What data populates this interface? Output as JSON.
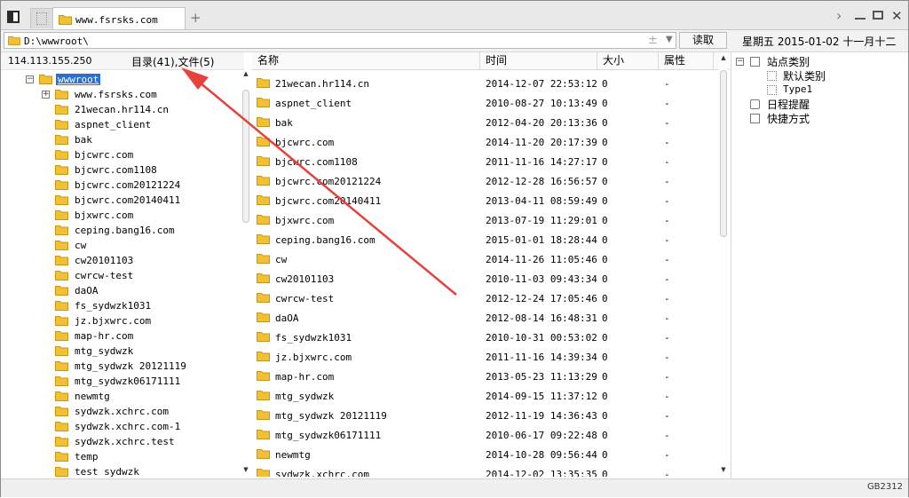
{
  "tab": {
    "title": "www.fsrsks.com"
  },
  "address": {
    "path": "D:\\wwwroot\\",
    "read_button": "读取",
    "date_text": "星期五 2015-01-02 十一月十二"
  },
  "info": {
    "ip": "114.113.155.250",
    "counts": "目录(41),文件(5)"
  },
  "tree": {
    "root": "wwwroot",
    "items": [
      "www.fsrsks.com",
      "21wecan.hr114.cn",
      "aspnet_client",
      "bak",
      "bjcwrc.com",
      "bjcwrc.com1108",
      "bjcwrc.com20121224",
      "bjcwrc.com20140411",
      "bjxwrc.com",
      "ceping.bang16.com",
      "cw",
      "cw20101103",
      "cwrcw-test",
      "daOA",
      "fs_sydwzk1031",
      "jz.bjxwrc.com",
      "map-hr.com",
      "mtg_sydwzk",
      "mtg_sydwzk 20121119",
      "mtg_sydwzk06171111",
      "newmtg",
      "sydwzk.xchrc.com",
      "sydwzk.xchrc.com-1",
      "sydwzk.xchrc.test",
      "temp",
      "test_sydwzk"
    ]
  },
  "columns": {
    "name": "名称",
    "time": "时间",
    "size": "大小",
    "attr": "属性"
  },
  "files": [
    {
      "name": "21wecan.hr114.cn",
      "time": "2014-12-07 22:53:12",
      "size": "0",
      "attr": "-"
    },
    {
      "name": "aspnet_client",
      "time": "2010-08-27 10:13:49",
      "size": "0",
      "attr": "-"
    },
    {
      "name": "bak",
      "time": "2012-04-20 20:13:36",
      "size": "0",
      "attr": "-"
    },
    {
      "name": "bjcwrc.com",
      "time": "2014-11-20 20:17:39",
      "size": "0",
      "attr": "-"
    },
    {
      "name": "bjcwrc.com1108",
      "time": "2011-11-16 14:27:17",
      "size": "0",
      "attr": "-"
    },
    {
      "name": "bjcwrc.com20121224",
      "time": "2012-12-28 16:56:57",
      "size": "0",
      "attr": "-"
    },
    {
      "name": "bjcwrc.com20140411",
      "time": "2013-04-11 08:59:49",
      "size": "0",
      "attr": "-"
    },
    {
      "name": "bjxwrc.com",
      "time": "2013-07-19 11:29:01",
      "size": "0",
      "attr": "-"
    },
    {
      "name": "ceping.bang16.com",
      "time": "2015-01-01 18:28:44",
      "size": "0",
      "attr": "-"
    },
    {
      "name": "cw",
      "time": "2014-11-26 11:05:46",
      "size": "0",
      "attr": "-"
    },
    {
      "name": "cw20101103",
      "time": "2010-11-03 09:43:34",
      "size": "0",
      "attr": "-"
    },
    {
      "name": "cwrcw-test",
      "time": "2012-12-24 17:05:46",
      "size": "0",
      "attr": "-"
    },
    {
      "name": "daOA",
      "time": "2012-08-14 16:48:31",
      "size": "0",
      "attr": "-"
    },
    {
      "name": "fs_sydwzk1031",
      "time": "2010-10-31 00:53:02",
      "size": "0",
      "attr": "-"
    },
    {
      "name": "jz.bjxwrc.com",
      "time": "2011-11-16 14:39:34",
      "size": "0",
      "attr": "-"
    },
    {
      "name": "map-hr.com",
      "time": "2013-05-23 11:13:29",
      "size": "0",
      "attr": "-"
    },
    {
      "name": "mtg_sydwzk",
      "time": "2014-09-15 11:37:12",
      "size": "0",
      "attr": "-"
    },
    {
      "name": "mtg_sydwzk 20121119",
      "time": "2012-11-19 14:36:43",
      "size": "0",
      "attr": "-"
    },
    {
      "name": "mtg_sydwzk06171111",
      "time": "2010-06-17 09:22:48",
      "size": "0",
      "attr": "-"
    },
    {
      "name": "newmtg",
      "time": "2014-10-28 09:56:44",
      "size": "0",
      "attr": "-"
    },
    {
      "name": "sydwzk.xchrc.com",
      "time": "2014-12-02 13:35:35",
      "size": "0",
      "attr": "-"
    }
  ],
  "right_panel": {
    "site_category": "站点类别",
    "default_category": "默认类别",
    "type1": "Type1",
    "schedule": "日程提醒",
    "shortcuts": "快捷方式"
  },
  "status": {
    "text": "GB2312"
  },
  "colors": {
    "folder": "#f2c035",
    "selection": "#2d6fd0",
    "annotation_arrow": "#e8403a"
  }
}
